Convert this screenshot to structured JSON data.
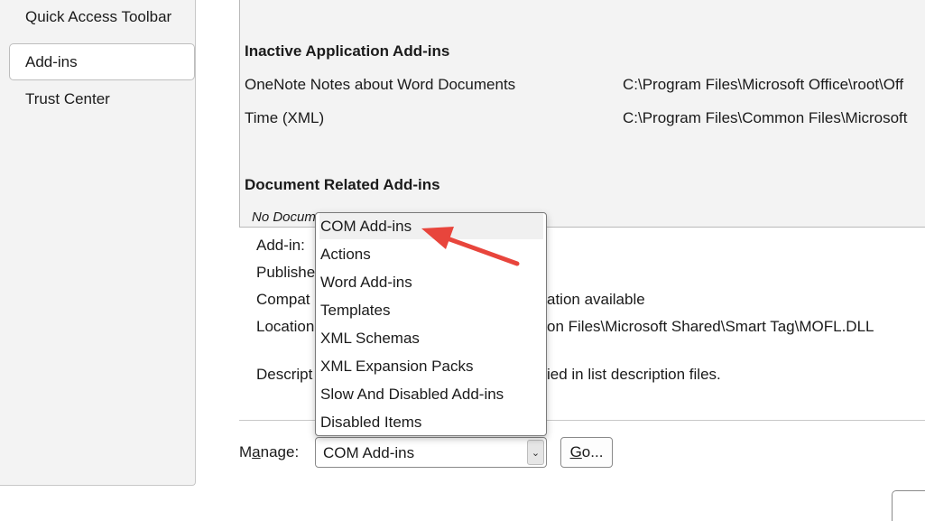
{
  "sidebar": {
    "items": [
      {
        "label": "Quick Access Toolbar"
      },
      {
        "label": "Add-ins"
      },
      {
        "label": "Trust Center"
      }
    ]
  },
  "addins": {
    "inactive_heading": "Inactive Application Add-ins",
    "inactive_rows": [
      {
        "name": "OneNote Notes about Word Documents",
        "location": "C:\\Program Files\\Microsoft Office\\root\\Off"
      },
      {
        "name": "Time (XML)",
        "location": "C:\\Program Files\\Common Files\\Microsoft"
      }
    ],
    "document_heading": "Document Related Add-ins",
    "no_document_text": "No Docum"
  },
  "details": {
    "addin_label": "Add-in:",
    "publisher_label": "Publishe",
    "compat_label": "Compat",
    "compat_value": "ation available",
    "location_label": "Location",
    "location_value": "on Files\\Microsoft Shared\\Smart Tag\\MOFL.DLL",
    "description_label": "Descript",
    "description_value": "ied in list description files."
  },
  "manage": {
    "label_prefix": "M",
    "label_underlined": "a",
    "label_suffix": "nage:",
    "selected": "COM Add-ins",
    "go_underlined": "G",
    "go_suffix": "o..."
  },
  "dropdown": {
    "options": [
      "COM Add-ins",
      "Actions",
      "Word Add-ins",
      "Templates",
      "XML Schemas",
      "XML Expansion Packs",
      "Slow And Disabled Add-ins",
      "Disabled Items"
    ],
    "highlighted_index": 0
  },
  "colors": {
    "annotation_arrow": "#e8453c",
    "panel_bg": "#f3f3f3"
  },
  "icons": {
    "select_arrow": "chevron-down-icon"
  }
}
